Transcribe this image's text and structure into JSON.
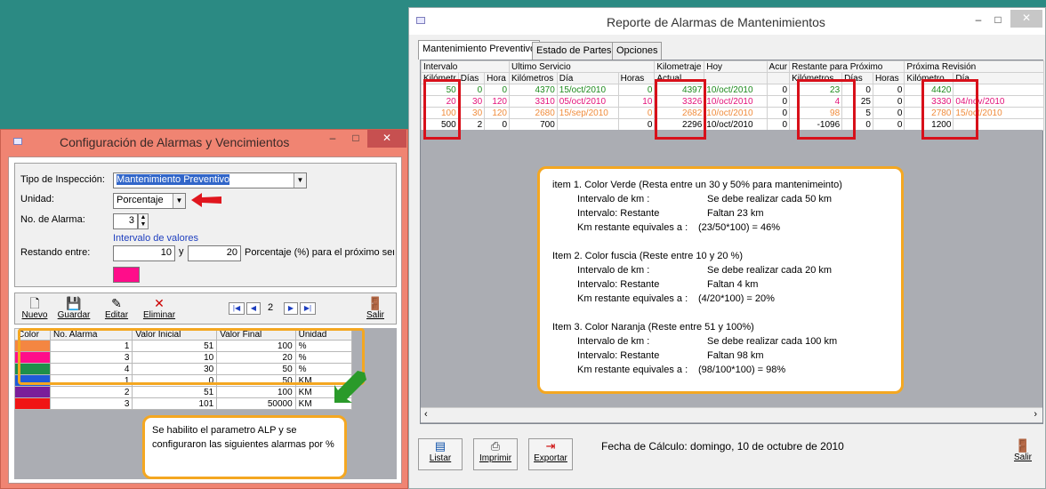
{
  "config_window": {
    "title": "Configuración de Alarmas y Vencimientos",
    "controls": {
      "minimize": "–",
      "maximize": "□",
      "close": "✕"
    },
    "fields": {
      "tipo_label": "Tipo de Inspección:",
      "tipo_value": "Mantenimiento Preventivo",
      "unidad_label": "Unidad:",
      "unidad_value": "Porcentaje",
      "alarma_label": "No. de Alarma:",
      "alarma_value": "3",
      "intervalo_label": "Intervalo de valores",
      "restando_label": "Restando entre:",
      "restando_from": "10",
      "y_label": "y",
      "restando_to": "20",
      "porcentaje_label": "Porcentaje (%) para el próximo servicio",
      "color_swatch": "#ff0d8a"
    },
    "toolbar": {
      "nuevo": "Nuevo",
      "guardar": "Guardar",
      "editar": "Editar",
      "eliminar": "Eliminar",
      "page": "2",
      "salir": "Salir"
    },
    "table": {
      "headers": [
        "Color",
        "No. Alarma",
        "Valor Inicial",
        "Valor Final",
        "Unidad"
      ],
      "rows": [
        {
          "color": "#f48642",
          "alarma": "1",
          "inicial": "51",
          "final": "100",
          "unidad": "%"
        },
        {
          "color": "#ff0d8a",
          "alarma": "3",
          "inicial": "10",
          "final": "20",
          "unidad": "%"
        },
        {
          "color": "#1e8f4a",
          "alarma": "4",
          "inicial": "30",
          "final": "50",
          "unidad": "%"
        },
        {
          "color": "#1e5bd8",
          "alarma": "1",
          "inicial": "0",
          "final": "50",
          "unidad": "KM"
        },
        {
          "color": "#7a1e9a",
          "alarma": "2",
          "inicial": "51",
          "final": "100",
          "unidad": "KM"
        },
        {
          "color": "#f01414",
          "alarma": "3",
          "inicial": "101",
          "final": "50000",
          "unidad": "KM"
        }
      ]
    },
    "note": "Se habilito el parametro ALP y se configuraron las siguientes alarmas por %"
  },
  "report_window": {
    "title": "Reporte de Alarmas de Mantenimientos",
    "controls": {
      "minimize": "–",
      "maximize": "□",
      "close": "✕"
    },
    "tabs": [
      "Mantenimiento Preventivo",
      "Estado de Partes",
      "Opciones"
    ],
    "header1": {
      "intervalo": "Intervalo",
      "ultimo": "Ultimo Servicio",
      "kilometraje": "Kilometraje",
      "hoy": "Hoy",
      "acum": "Acur",
      "restante": "Restante para Próximo",
      "proxima": "Próxima Revisión"
    },
    "header2": {
      "km": "Kilómetr",
      "dias": "Días",
      "horas": "Hora",
      "km2": "Kilómetros",
      "dia": "Día",
      "horas2": "Horas",
      "actual": "Actual",
      "km3": "Kilómetros",
      "dias2": "Días",
      "horas3": "Horas",
      "km4": "Kilómetro",
      "dia2": "Día"
    },
    "rows": [
      {
        "cls": "green",
        "km": "50",
        "dias": "0",
        "horas": "0",
        "ukm": "4370",
        "udia": "15/oct/2010",
        "uhoras": "0",
        "actual": "4397",
        "hoy": "10/oct/2010",
        "acum": "0",
        "rkm": "23",
        "rdias": "0",
        "rhoras": "0",
        "pkm": "4420",
        "pdia": ""
      },
      {
        "cls": "fuchsia",
        "km": "20",
        "dias": "30",
        "horas": "120",
        "ukm": "3310",
        "udia": "05/oct/2010",
        "uhoras": "10",
        "actual": "3326",
        "hoy": "10/oct/2010",
        "acum": "0",
        "rkm": "4",
        "rdias": "25",
        "rhoras": "0",
        "pkm": "3330",
        "pdia": "04/nov/2010"
      },
      {
        "cls": "orange",
        "km": "100",
        "dias": "30",
        "horas": "120",
        "ukm": "2680",
        "udia": "15/sep/2010",
        "uhoras": "0",
        "actual": "2682",
        "hoy": "10/oct/2010",
        "acum": "0",
        "rkm": "98",
        "rdias": "5",
        "rhoras": "0",
        "pkm": "2780",
        "pdia": "15/oct/2010"
      },
      {
        "cls": "",
        "km": "500",
        "dias": "2",
        "horas": "0",
        "ukm": "700",
        "udia": "",
        "uhoras": "0",
        "actual": "2296",
        "hoy": "10/oct/2010",
        "acum": "0",
        "rkm": "-1096",
        "rdias": "0",
        "rhoras": "0",
        "pkm": "1200",
        "pdia": ""
      }
    ],
    "note": {
      "item1_title": "item 1. Color Verde (Resta entre un 30 y 50% para mantenimeinto)",
      "item1_l1a": "Intervalo de km :",
      "item1_l1b": "Se debe realizar cada 50 km",
      "item1_l2a": "Intervalo: Restante",
      "item1_l2b": "Faltan 23 km",
      "item1_l3a": "Km restante equivales a :",
      "item1_l3b": "(23/50*100)  = 46%",
      "item2_title": "Item 2. Color fuscia   (Reste entre 10 y 20 %)",
      "item2_l1a": "Intervalo de km :",
      "item2_l1b": "Se debe realizar cada 20 km",
      "item2_l2a": "Intervalo: Restante",
      "item2_l2b": "Faltan 4 km",
      "item2_l3a": "Km restante equivales a :",
      "item2_l3b": "(4/20*100)  = 20%",
      "item3_title": "Item 3. Color Naranja (Reste entre 51 y 100%)",
      "item3_l1a": "Intervalo de km :",
      "item3_l1b": "Se debe realizar cada 100 km",
      "item3_l2a": "Intervalo: Restante",
      "item3_l2b": "Faltan 98 km",
      "item3_l3a": "Km restante equivales a :",
      "item3_l3b": "(98/100*100)  = 98%"
    },
    "bottom": {
      "listar": "Listar",
      "imprimir": "Imprimir",
      "exportar": "Exportar",
      "fecha": "Fecha de Cálculo: domingo, 10 de octubre de 2010",
      "salir": "Salir"
    }
  }
}
